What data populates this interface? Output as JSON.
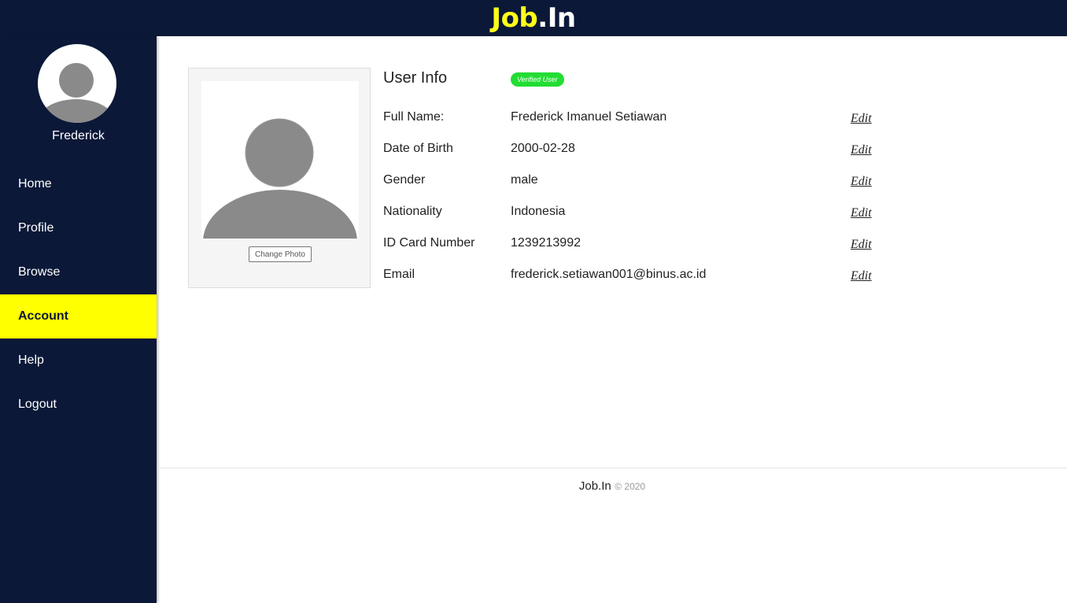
{
  "header": {
    "logo_part1": "Job",
    "logo_part2": ".In"
  },
  "sidebar": {
    "username": "Frederick",
    "items": [
      {
        "label": "Home"
      },
      {
        "label": "Profile"
      },
      {
        "label": "Browse"
      },
      {
        "label": "Account",
        "active": true
      },
      {
        "label": "Help"
      },
      {
        "label": "Logout"
      }
    ]
  },
  "profile": {
    "change_photo_label": "Change Photo",
    "info_title": "User Info",
    "badge": "Verified User",
    "edit_label": "Edit",
    "fields": [
      {
        "label": "Full Name:",
        "value": "Frederick Imanuel Setiawan"
      },
      {
        "label": "Date of Birth",
        "value": "2000-02-28"
      },
      {
        "label": "Gender",
        "value": "male"
      },
      {
        "label": "Nationality",
        "value": "Indonesia"
      },
      {
        "label": "ID Card Number",
        "value": "1239213992"
      },
      {
        "label": "Email",
        "value": "frederick.setiawan001@binus.ac.id"
      }
    ]
  },
  "footer": {
    "brand": "Job.In",
    "copyright": "© 2020"
  },
  "colors": {
    "navy": "#0b1838",
    "accent": "#ffff00",
    "verified": "#22dd33"
  }
}
